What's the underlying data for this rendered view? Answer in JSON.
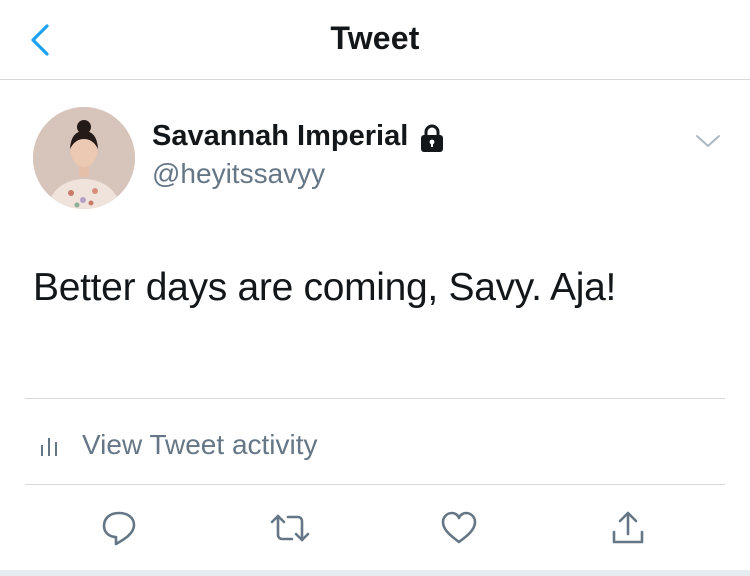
{
  "nav": {
    "title": "Tweet",
    "back_icon": "chevron-left-icon"
  },
  "author": {
    "display_name": "Savannah Imperial",
    "handle": "@heyitssavyy",
    "protected_icon": "lock-icon"
  },
  "tweet": {
    "text": "Better days are coming, Savy. Aja!"
  },
  "activity": {
    "label": "View Tweet activity",
    "icon": "bar-chart-icon"
  },
  "actions": [
    {
      "name": "reply",
      "icon": "speech-bubble-icon"
    },
    {
      "name": "retweet",
      "icon": "retweet-icon"
    },
    {
      "name": "like",
      "icon": "heart-icon"
    },
    {
      "name": "share",
      "icon": "share-icon"
    }
  ],
  "colors": {
    "accent": "#1da1f2",
    "secondary_text": "#657786",
    "primary_text": "#14171a",
    "divider": "#d5d9dc"
  }
}
